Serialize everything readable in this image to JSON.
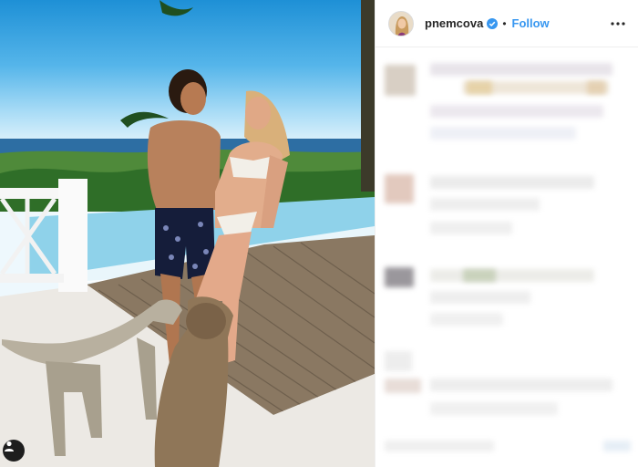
{
  "post": {
    "username": "pnemcova",
    "verified": true,
    "separator": "•",
    "follow_label": "Follow",
    "more_icon": "more-horizontal-icon",
    "tag_icon": "user-tag-icon"
  },
  "colors": {
    "follow_blue": "#3897f0",
    "verified_blue": "#3897f0",
    "text_dark": "#262626",
    "border": "#efefef"
  }
}
